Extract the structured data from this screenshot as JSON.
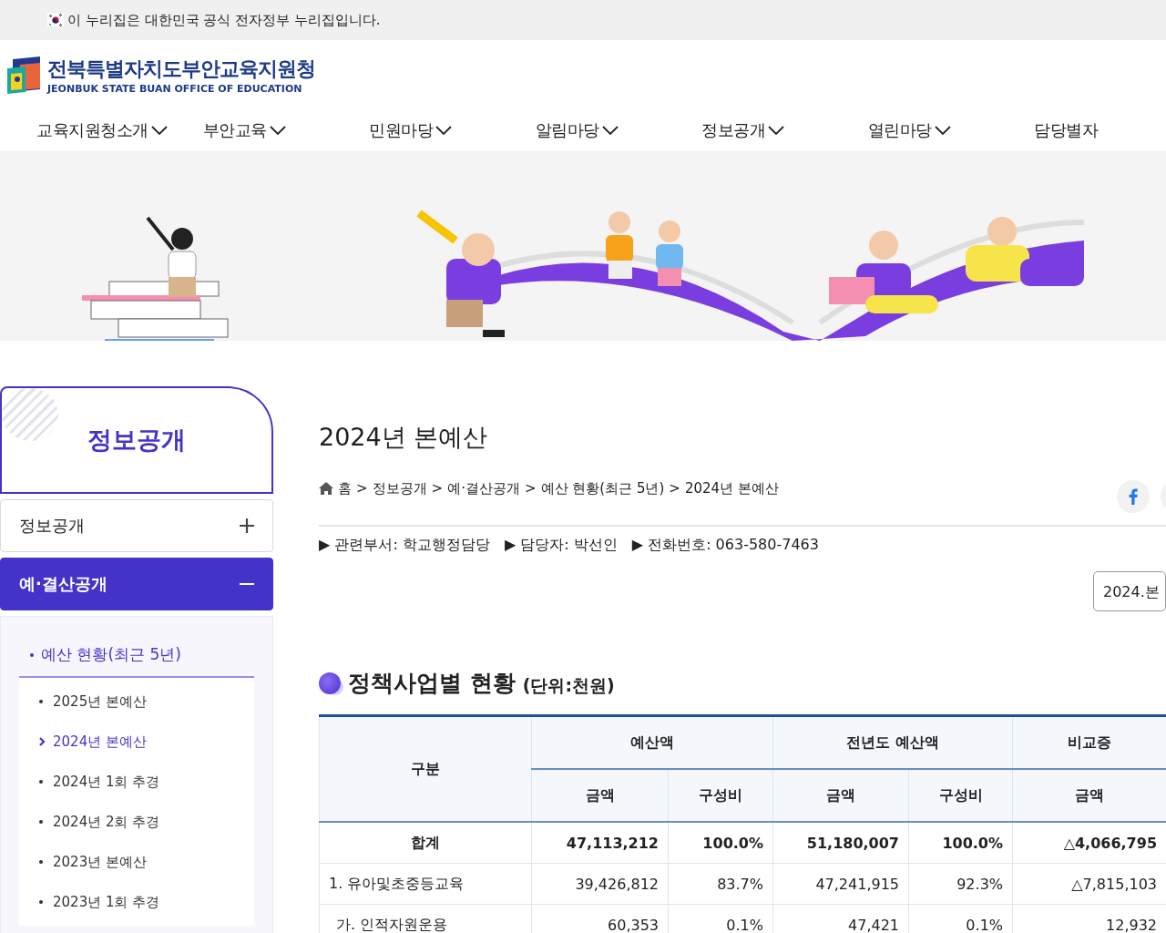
{
  "gov_banner": {
    "text": "이 누리집은 대한민국 공식 전자정부 누리집입니다."
  },
  "logo": {
    "name_ko": "전북특별자치도부안교육지원청",
    "name_en": "JEONBUK STATE BUAN OFFICE OF EDUCATION"
  },
  "nav": [
    {
      "label": "교육지원청소개"
    },
    {
      "label": "부안교육"
    },
    {
      "label": "민원마당"
    },
    {
      "label": "알림마당"
    },
    {
      "label": "정보공개"
    },
    {
      "label": "열린마당"
    },
    {
      "label": "담당별자"
    }
  ],
  "sidebar": {
    "title": "정보공개",
    "menu": [
      {
        "label": "정보공개",
        "expanded": false
      },
      {
        "label": "예·결산공개",
        "expanded": true,
        "children": [
          {
            "label": "예산 현황(최근 5년)",
            "selected": true,
            "children": [
              {
                "label": "2025년 본예산",
                "selected": false
              },
              {
                "label": "2024년 본예산",
                "selected": true
              },
              {
                "label": "2024년 1회 추경",
                "selected": false
              },
              {
                "label": "2024년 2회 추경",
                "selected": false
              },
              {
                "label": "2023년 본예산",
                "selected": false
              },
              {
                "label": "2023년 1회 추경",
                "selected": false
              }
            ]
          }
        ]
      }
    ]
  },
  "page": {
    "title": "2024년 본예산",
    "breadcrumb": {
      "separator": ">",
      "items": [
        "홈",
        "정보공개",
        "예·결산공개",
        "예산 현황(최근 5년)",
        "2024년 본예산"
      ]
    },
    "info": [
      "▶ 관련부서: 학교행정담당",
      "▶ 담당자: 박선인",
      "▶ 전화번호: 063-580-7463"
    ],
    "select": {
      "value": "2024.본"
    }
  },
  "section": {
    "title": "정책사업별 현황",
    "unit": "(단위:천원)"
  },
  "table": {
    "groups": [
      {
        "label": "구분"
      },
      {
        "label": "예산액",
        "sub": [
          "금액",
          "구성비"
        ]
      },
      {
        "label": "전년도 예산액",
        "sub": [
          "금액",
          "구성비"
        ]
      },
      {
        "label": "비교증",
        "sub": [
          "금액"
        ]
      }
    ],
    "rows": [
      {
        "kind": "total",
        "cells": [
          "합계",
          "47,113,212",
          "100.0%",
          "51,180,007",
          "100.0%",
          "△4,066,795"
        ]
      },
      {
        "kind": "level1",
        "cells": [
          "1. 유아및초중등교육",
          "39,426,812",
          "83.7%",
          "47,241,915",
          "92.3%",
          "△7,815,103"
        ]
      },
      {
        "kind": "level2",
        "cells": [
          "가. 인적자원운용",
          "60,353",
          "0.1%",
          "47,421",
          "0.1%",
          "12,932"
        ]
      }
    ]
  }
}
